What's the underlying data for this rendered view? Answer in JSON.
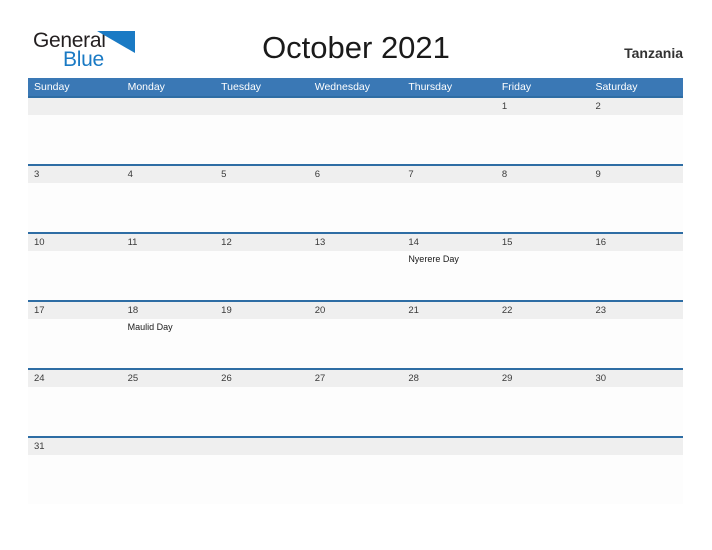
{
  "brand": {
    "name_part1": "General",
    "name_part2": "Blue",
    "flag_icon": "blue-triangle-flag-icon",
    "color_dark": "#231f20",
    "color_blue": "#1a7ac4"
  },
  "header": {
    "title": "October 2021",
    "country": "Tanzania"
  },
  "colors": {
    "header_bar": "#3a78b5",
    "row_divider": "#2e6da4",
    "date_band": "#efefef",
    "cell_bg": "#fdfdfd"
  },
  "calendar": {
    "month": "October",
    "year": "2021",
    "weekdays": [
      "Sunday",
      "Monday",
      "Tuesday",
      "Wednesday",
      "Thursday",
      "Friday",
      "Saturday"
    ],
    "weeks": [
      {
        "days": [
          {
            "num": "",
            "event": ""
          },
          {
            "num": "",
            "event": ""
          },
          {
            "num": "",
            "event": ""
          },
          {
            "num": "",
            "event": ""
          },
          {
            "num": "",
            "event": ""
          },
          {
            "num": "1",
            "event": ""
          },
          {
            "num": "2",
            "event": ""
          }
        ]
      },
      {
        "days": [
          {
            "num": "3",
            "event": ""
          },
          {
            "num": "4",
            "event": ""
          },
          {
            "num": "5",
            "event": ""
          },
          {
            "num": "6",
            "event": ""
          },
          {
            "num": "7",
            "event": ""
          },
          {
            "num": "8",
            "event": ""
          },
          {
            "num": "9",
            "event": ""
          }
        ]
      },
      {
        "days": [
          {
            "num": "10",
            "event": ""
          },
          {
            "num": "11",
            "event": ""
          },
          {
            "num": "12",
            "event": ""
          },
          {
            "num": "13",
            "event": ""
          },
          {
            "num": "14",
            "event": "Nyerere Day"
          },
          {
            "num": "15",
            "event": ""
          },
          {
            "num": "16",
            "event": ""
          }
        ]
      },
      {
        "days": [
          {
            "num": "17",
            "event": ""
          },
          {
            "num": "18",
            "event": "Maulid Day"
          },
          {
            "num": "19",
            "event": ""
          },
          {
            "num": "20",
            "event": ""
          },
          {
            "num": "21",
            "event": ""
          },
          {
            "num": "22",
            "event": ""
          },
          {
            "num": "23",
            "event": ""
          }
        ]
      },
      {
        "days": [
          {
            "num": "24",
            "event": ""
          },
          {
            "num": "25",
            "event": ""
          },
          {
            "num": "26",
            "event": ""
          },
          {
            "num": "27",
            "event": ""
          },
          {
            "num": "28",
            "event": ""
          },
          {
            "num": "29",
            "event": ""
          },
          {
            "num": "30",
            "event": ""
          }
        ]
      },
      {
        "days": [
          {
            "num": "31",
            "event": ""
          },
          {
            "num": "",
            "event": ""
          },
          {
            "num": "",
            "event": ""
          },
          {
            "num": "",
            "event": ""
          },
          {
            "num": "",
            "event": ""
          },
          {
            "num": "",
            "event": ""
          },
          {
            "num": "",
            "event": ""
          }
        ]
      }
    ]
  }
}
